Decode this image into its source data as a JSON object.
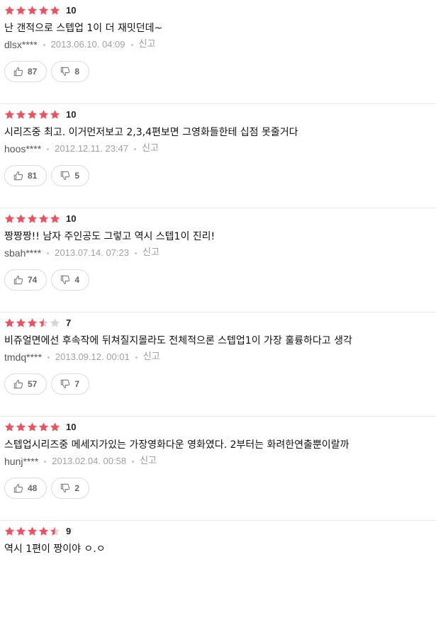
{
  "colors": {
    "star_filled": "#f0505d",
    "star_empty": "#d6d6d6"
  },
  "icons": {
    "like": "thumbs-up-icon",
    "dislike": "thumbs-down-icon",
    "star": "star-icon"
  },
  "reviews": [
    {
      "stars": 5,
      "score": "10",
      "comment": "난 갠적으로 스텝업 1이 더 재밋던데~",
      "user": "dlsx****",
      "date": "2013.06.10. 04:09",
      "report": "신고",
      "likes": "87",
      "dislikes": "8"
    },
    {
      "stars": 5,
      "score": "10",
      "comment": "시리즈중 최고. 이거먼저보고 2,3,4편보면 그영화들한테 십점 못줄거다",
      "user": "hoos****",
      "date": "2012.12.11. 23:47",
      "report": "신고",
      "likes": "81",
      "dislikes": "5"
    },
    {
      "stars": 5,
      "score": "10",
      "comment": "짱짱짱!! 남자 주인공도 그렇고 역시 스텝1이 진리!",
      "user": "sbah****",
      "date": "2013.07.14. 07:23",
      "report": "신고",
      "likes": "74",
      "dislikes": "4"
    },
    {
      "stars": 3.5,
      "score": "7",
      "comment": "비쥬얼면에선 후속작에 뒤쳐질지몰라도 전체적으론 스텝업1이 가장 훌륭하다고 생각",
      "user": "tmdq****",
      "date": "2013.09.12. 00:01",
      "report": "신고",
      "likes": "57",
      "dislikes": "7"
    },
    {
      "stars": 5,
      "score": "10",
      "comment": "스텝업시리즈중 메세지가있는 가장영화다운 영화였다. 2부터는 화려한연출뿐이랄까",
      "user": "hunj****",
      "date": "2013.02.04. 00:58",
      "report": "신고",
      "likes": "48",
      "dislikes": "2"
    },
    {
      "stars": 4.5,
      "score": "9",
      "comment": "역시 1편이 짱이야 ㅇ.ㅇ"
    }
  ]
}
